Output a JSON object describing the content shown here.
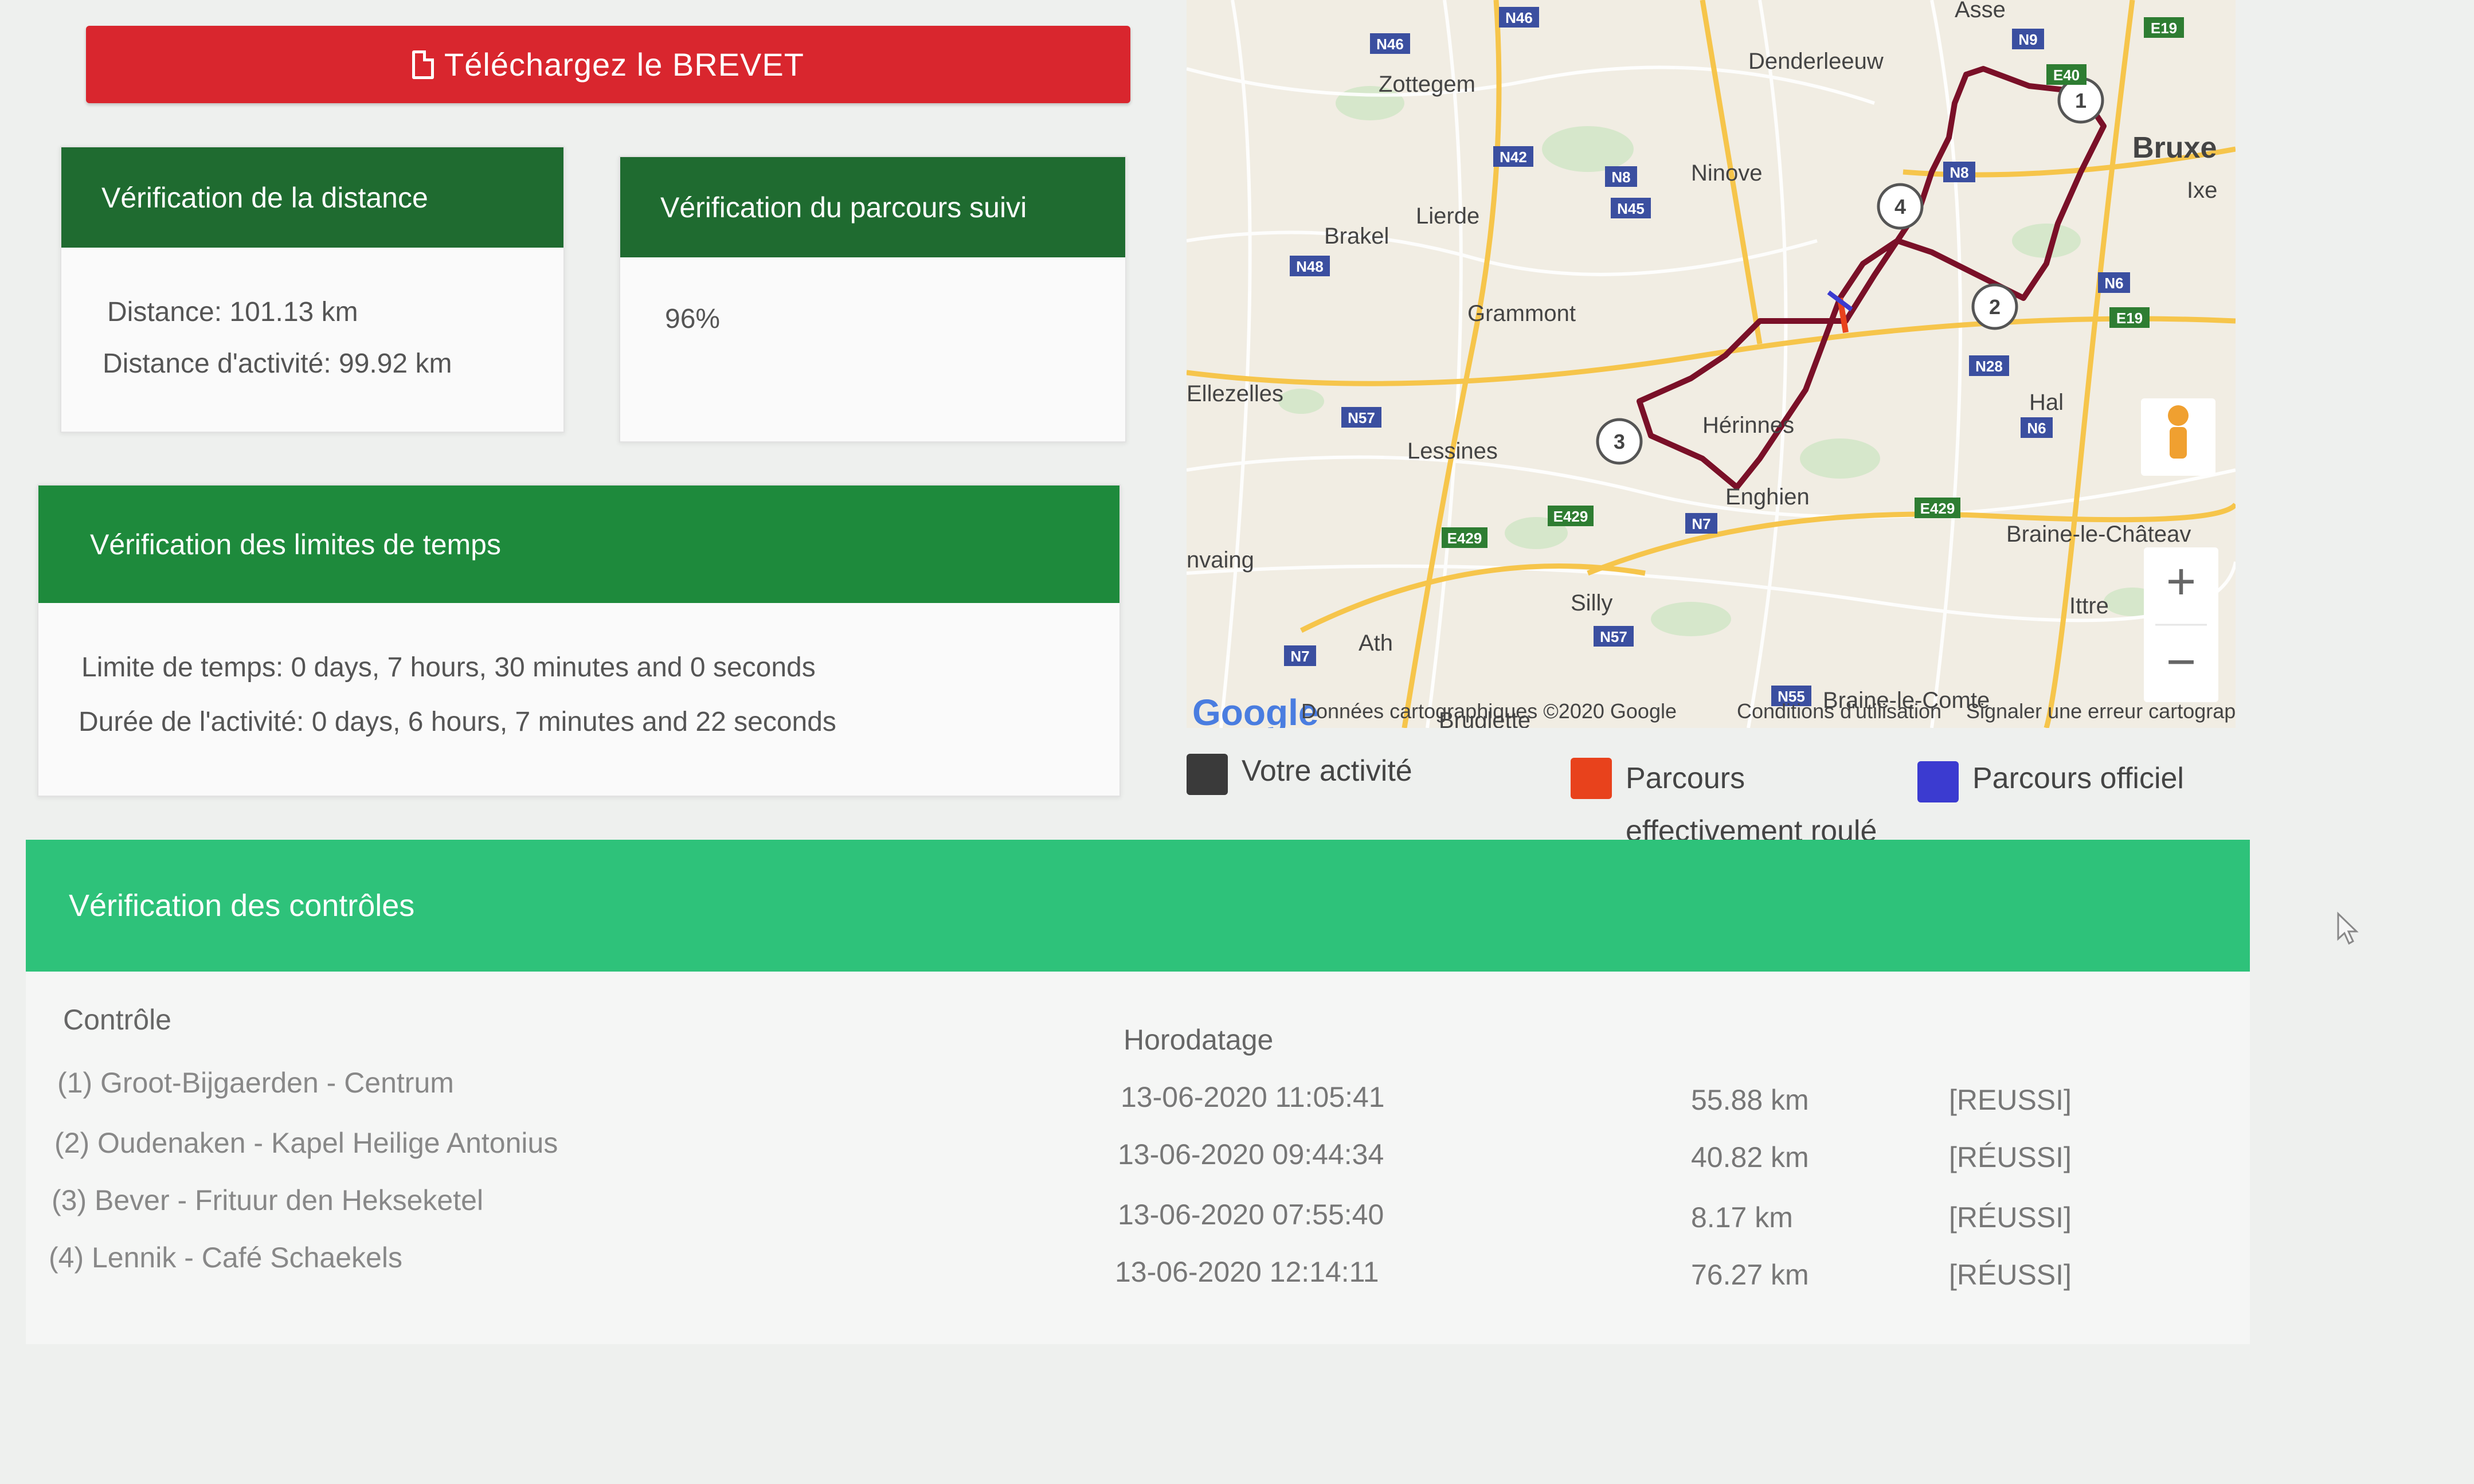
{
  "download": {
    "label": "Téléchargez le BREVET"
  },
  "distance_card": {
    "title": "Vérification de la distance",
    "distance": "Distance: 101.13 km",
    "activity_distance": "Distance d'activité: 99.92 km"
  },
  "route_card": {
    "title": "Vérification du parcours suivi",
    "value": "96%"
  },
  "time_card": {
    "title": "Vérification des limites de temps",
    "limit": "Limite de temps: 0 days, 7 hours, 30 minutes and 0 seconds",
    "duration": "Durée de l'activité: 0 days, 6 hours, 7 minutes and 22 seconds"
  },
  "map": {
    "places": [
      "Zottegem",
      "Denderleeuw",
      "Asse",
      "Bruxe",
      "Ixe",
      "Ninove",
      "Lierde",
      "Brakel",
      "Grammont",
      "Ellezelles",
      "Lessines",
      "Hérinnes",
      "Enghien",
      "Hal",
      "Braine-le-Châteav",
      "Ittre",
      "Silly",
      "Ath",
      "nvaing",
      "Braine-le-Comte",
      "Bruglette"
    ],
    "roads": [
      "N46",
      "N46",
      "N9",
      "E19",
      "E40",
      "N42",
      "N8",
      "N45",
      "N8",
      "N48",
      "N6",
      "E19",
      "N28",
      "N57",
      "N6",
      "E429",
      "E429",
      "N7",
      "E429",
      "N7",
      "N57",
      "N55"
    ],
    "markers": [
      "1",
      "2",
      "3",
      "4"
    ],
    "google_logo": "Google",
    "attribution": "Données cartographiques ©2020 Google",
    "terms": "Conditions d'utilisation",
    "report": "Signaler une erreur cartographique",
    "zoom_in": "+",
    "zoom_out": "−",
    "colors": {
      "activity": "#3a3a3a",
      "actual": "#e8421c",
      "official": "#3b3bd0",
      "route": "#7a1028"
    }
  },
  "legend": {
    "activity": "Votre activité",
    "actual_line1": "Parcours",
    "actual_line2": "effectivement roulé",
    "official": "Parcours officiel"
  },
  "controls": {
    "title": "Vérification des contrôles",
    "headers": {
      "control": "Contrôle",
      "timestamp": "Horodatage"
    },
    "rows": [
      {
        "name": "(1) Groot-Bijgaerden - Centrum",
        "time": "13-06-2020 11:05:41",
        "distance": "55.88 km",
        "status": "[REUSSI]"
      },
      {
        "name": "(2) Oudenaken - Kapel Heilige Antonius",
        "time": "13-06-2020 09:44:34",
        "distance": "40.82 km",
        "status": "[RÉUSSI]"
      },
      {
        "name": "(3) Bever - Frituur den Hekseketel",
        "time": "13-06-2020 07:55:40",
        "distance": "8.17 km",
        "status": "[RÉUSSI]"
      },
      {
        "name": "(4) Lennik - Café Schaekels",
        "time": "13-06-2020 12:14:11",
        "distance": "76.27 km",
        "status": "[RÉUSSI]"
      }
    ]
  }
}
